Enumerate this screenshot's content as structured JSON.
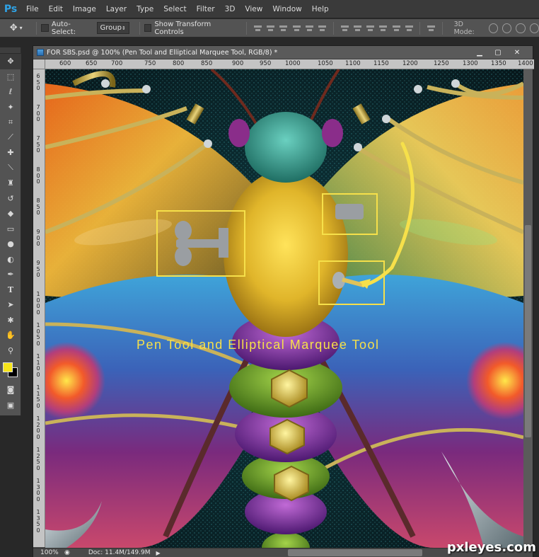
{
  "app": {
    "logo": "Ps"
  },
  "menu": [
    "File",
    "Edit",
    "Image",
    "Layer",
    "Type",
    "Select",
    "Filter",
    "3D",
    "View",
    "Window",
    "Help"
  ],
  "options": {
    "auto_select_label": "Auto-Select:",
    "auto_select_value": "Group",
    "show_transform_label": "Show Transform Controls",
    "mode_3d_label": "3D Mode:"
  },
  "document": {
    "title": "FOR SBS.psd @ 100% (Pen Tool and Elliptical Marquee Tool, RGB/8) *",
    "ruler_top": [
      "600",
      "650",
      "700",
      "750",
      "800",
      "850",
      "900",
      "950",
      "1000",
      "1050",
      "1100",
      "1150",
      "1200",
      "1250",
      "1300",
      "1350",
      "1400"
    ],
    "ruler_left": [
      "650",
      "700",
      "750",
      "800",
      "850",
      "900",
      "950",
      "1000",
      "1050",
      "1100",
      "1150",
      "1200",
      "1250",
      "1300",
      "1350"
    ],
    "canvas_caption": "Pen Tool and Elliptical Marquee Tool"
  },
  "status": {
    "zoom": "100%",
    "doc": "Doc: 11.4M/149.9M"
  },
  "colors": {
    "foreground": "#f7e51a",
    "background": "#000000",
    "accent": "#2fa3e6"
  },
  "watermark": "pxleyes.com",
  "tools": [
    "move-icon",
    "marquee-icon",
    "lasso-icon",
    "magic-wand-icon",
    "crop-icon",
    "eyedropper-icon",
    "healing-icon",
    "brush-icon",
    "stamp-icon",
    "history-brush-icon",
    "eraser-icon",
    "gradient-icon",
    "blur-icon",
    "dodge-icon",
    "pen-icon",
    "type-icon",
    "path-select-icon",
    "shape-icon",
    "hand-icon",
    "zoom-icon"
  ]
}
